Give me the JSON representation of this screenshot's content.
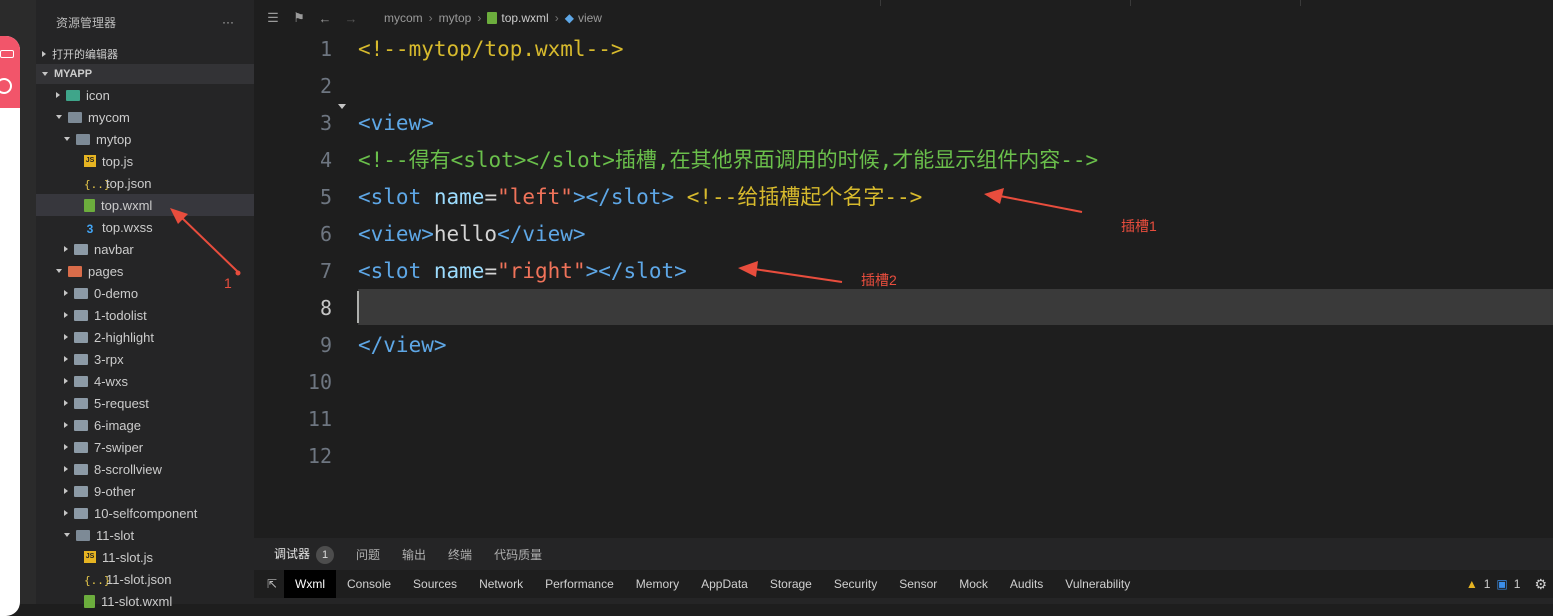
{
  "explorer": {
    "title": "资源管理器",
    "more": "···",
    "open_editors": "打开的编辑器",
    "project": "MYAPP",
    "tree": [
      {
        "label": "icon",
        "depth": 0,
        "type": "folder-green",
        "expanded": false
      },
      {
        "label": "mycom",
        "depth": 0,
        "type": "folder",
        "expanded": true
      },
      {
        "label": "mytop",
        "depth": 1,
        "type": "folder",
        "expanded": true
      },
      {
        "label": "top.js",
        "depth": 2,
        "type": "js"
      },
      {
        "label": "top.json",
        "depth": 2,
        "type": "json"
      },
      {
        "label": "top.wxml",
        "depth": 2,
        "type": "wxml",
        "selected": true
      },
      {
        "label": "top.wxss",
        "depth": 2,
        "type": "wxss"
      },
      {
        "label": "navbar",
        "depth": 1,
        "type": "folder",
        "expanded": false
      },
      {
        "label": "pages",
        "depth": 0,
        "type": "folder-red",
        "expanded": true
      },
      {
        "label": "0-demo",
        "depth": 1,
        "type": "folder",
        "expanded": false
      },
      {
        "label": "1-todolist",
        "depth": 1,
        "type": "folder",
        "expanded": false
      },
      {
        "label": "2-highlight",
        "depth": 1,
        "type": "folder",
        "expanded": false
      },
      {
        "label": "3-rpx",
        "depth": 1,
        "type": "folder",
        "expanded": false
      },
      {
        "label": "4-wxs",
        "depth": 1,
        "type": "folder",
        "expanded": false
      },
      {
        "label": "5-request",
        "depth": 1,
        "type": "folder",
        "expanded": false
      },
      {
        "label": "6-image",
        "depth": 1,
        "type": "folder",
        "expanded": false
      },
      {
        "label": "7-swiper",
        "depth": 1,
        "type": "folder",
        "expanded": false
      },
      {
        "label": "8-scrollview",
        "depth": 1,
        "type": "folder",
        "expanded": false
      },
      {
        "label": "9-other",
        "depth": 1,
        "type": "folder",
        "expanded": false
      },
      {
        "label": "10-selfcomponent",
        "depth": 1,
        "type": "folder",
        "expanded": false
      },
      {
        "label": "11-slot",
        "depth": 1,
        "type": "folder",
        "expanded": true
      },
      {
        "label": "11-slot.js",
        "depth": 2,
        "type": "js"
      },
      {
        "label": "11-slot.json",
        "depth": 2,
        "type": "json"
      },
      {
        "label": "11-slot.wxml",
        "depth": 2,
        "type": "wxml"
      }
    ]
  },
  "breadcrumb": {
    "parts": [
      "mycom",
      "mytop",
      "top.wxml",
      "view"
    ]
  },
  "editor": {
    "line_numbers": [
      "1",
      "2",
      "3",
      "4",
      "5",
      "6",
      "7",
      "8",
      "9",
      "10",
      "11",
      "12"
    ],
    "active_line": "8",
    "lines": [
      [
        {
          "t": "<!--mytop/top.wxml-->",
          "c": "com"
        }
      ],
      [],
      [
        {
          "t": "<view>",
          "c": "tag"
        }
      ],
      [
        {
          "t": "<!--得有<slot></slot>插槽,在其他界面调用的时候,才能显示组件内容-->",
          "c": "com2"
        }
      ],
      [
        {
          "t": "<slot",
          "c": "tag"
        },
        {
          "t": " name",
          "c": "attr"
        },
        {
          "t": "=",
          "c": "eq"
        },
        {
          "t": "\"left\"",
          "c": "str"
        },
        {
          "t": "></slot>",
          "c": "tag"
        },
        {
          "t": " <!--给插槽起个名字-->",
          "c": "com"
        }
      ],
      [
        {
          "t": "<view>",
          "c": "tag"
        },
        {
          "t": "hello",
          "c": "txt"
        },
        {
          "t": "</view>",
          "c": "tag"
        }
      ],
      [
        {
          "t": "<slot",
          "c": "tag"
        },
        {
          "t": " name",
          "c": "attr"
        },
        {
          "t": "=",
          "c": "eq"
        },
        {
          "t": "\"right\"",
          "c": "str"
        },
        {
          "t": "></slot>",
          "c": "tag"
        }
      ],
      [],
      [
        {
          "t": "</view>",
          "c": "tag"
        }
      ],
      [],
      [],
      []
    ]
  },
  "annotations": {
    "slot1": "插槽1",
    "slot2": "插槽2",
    "marker1": "1"
  },
  "panel": {
    "tabs": [
      "调试器",
      "问题",
      "输出",
      "终端",
      "代码质量"
    ],
    "debugger_badge": "1",
    "devtools_tabs": [
      "Wxml",
      "Console",
      "Sources",
      "Network",
      "Performance",
      "Memory",
      "AppData",
      "Storage",
      "Security",
      "Sensor",
      "Mock",
      "Audits",
      "Vulnerability"
    ],
    "warnings": "1",
    "messages": "1"
  },
  "colors": {
    "annotation_red": "#e84d3d",
    "comment_yellow": "#d7ba2d",
    "comment_green": "#6abf4b",
    "tag_blue": "#5ea7e6",
    "string_red": "#f0735a"
  }
}
